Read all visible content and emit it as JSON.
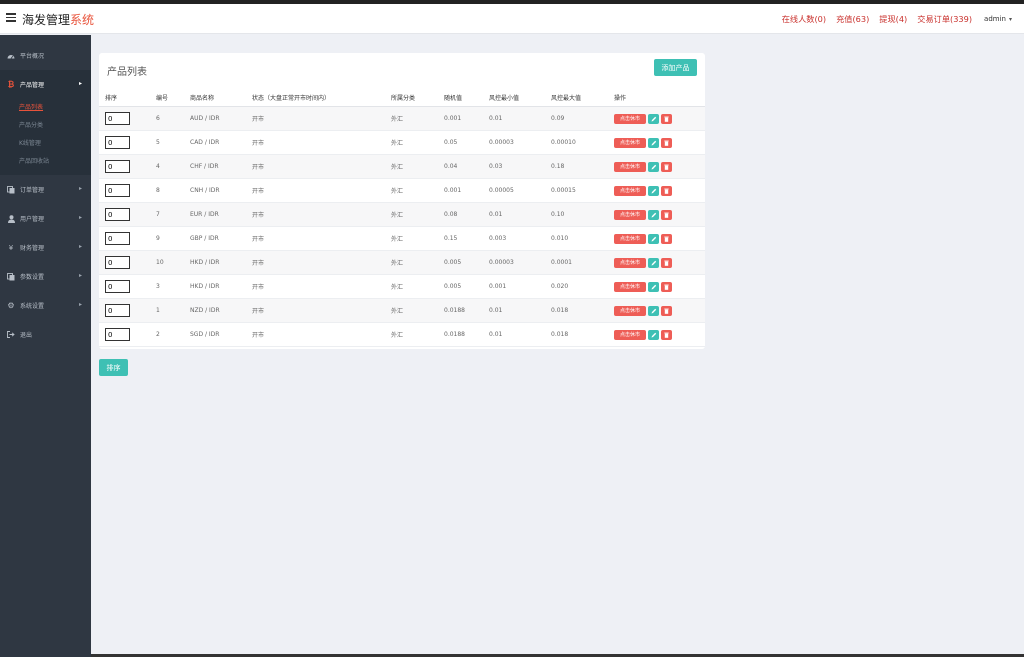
{
  "header": {
    "brand_main": "海发管理",
    "brand_accent": "系统",
    "links": [
      "在线人数(0)",
      "充值(63)",
      "提现(4)",
      "交易订单(339)"
    ],
    "user": "admin"
  },
  "sidebar": {
    "items": [
      {
        "label": "平台概况",
        "icon": "dashboard-icon"
      },
      {
        "label": "产品管理",
        "icon": "bitcoin-icon",
        "active": true,
        "sub": [
          "产品列表",
          "产品分类",
          "K线管理",
          "产品回收站"
        ]
      },
      {
        "label": "订单管理",
        "icon": "copy-icon"
      },
      {
        "label": "用户管理",
        "icon": "user-icon"
      },
      {
        "label": "财务管理",
        "icon": "yen-icon"
      },
      {
        "label": "参数设置",
        "icon": "file-icon"
      },
      {
        "label": "系统设置",
        "icon": "cogs-icon"
      },
      {
        "label": "退出",
        "icon": "sign-out-icon"
      }
    ]
  },
  "panel": {
    "title": "产品列表",
    "add_button": "添加产品",
    "sort_button": "排序",
    "headers": [
      "排序",
      "编号",
      "商品名称",
      "状态（大盘正常开市时间内）",
      "所属分类",
      "随机值",
      "风控最小值",
      "风控最大值",
      "操作"
    ],
    "action_close": "点击休市",
    "rows": [
      {
        "sort": "0",
        "id": "6",
        "name": "AUD / IDR",
        "status": "开市",
        "category": "外汇",
        "random": "0.001",
        "min": "0.01",
        "max": "0.09"
      },
      {
        "sort": "0",
        "id": "5",
        "name": "CAD / IDR",
        "status": "开市",
        "category": "外汇",
        "random": "0.05",
        "min": "0.00003",
        "max": "0.00010"
      },
      {
        "sort": "0",
        "id": "4",
        "name": "CHF / IDR",
        "status": "开市",
        "category": "外汇",
        "random": "0.04",
        "min": "0.03",
        "max": "0.18"
      },
      {
        "sort": "0",
        "id": "8",
        "name": "CNH / IDR",
        "status": "开市",
        "category": "外汇",
        "random": "0.001",
        "min": "0.00005",
        "max": "0.00015"
      },
      {
        "sort": "0",
        "id": "7",
        "name": "EUR / IDR",
        "status": "开市",
        "category": "外汇",
        "random": "0.08",
        "min": "0.01",
        "max": "0.10"
      },
      {
        "sort": "0",
        "id": "9",
        "name": "GBP / IDR",
        "status": "开市",
        "category": "外汇",
        "random": "0.15",
        "min": "0.003",
        "max": "0.010"
      },
      {
        "sort": "0",
        "id": "10",
        "name": "HKD / IDR",
        "status": "开市",
        "category": "外汇",
        "random": "0.005",
        "min": "0.00003",
        "max": "0.0001"
      },
      {
        "sort": "0",
        "id": "3",
        "name": "HKD / IDR",
        "status": "开市",
        "category": "外汇",
        "random": "0.005",
        "min": "0.001",
        "max": "0.020"
      },
      {
        "sort": "0",
        "id": "1",
        "name": "NZD / IDR",
        "status": "开市",
        "category": "外汇",
        "random": "0.0188",
        "min": "0.01",
        "max": "0.018"
      },
      {
        "sort": "0",
        "id": "2",
        "name": "SGD / IDR",
        "status": "开市",
        "category": "外汇",
        "random": "0.0188",
        "min": "0.01",
        "max": "0.018"
      }
    ]
  }
}
